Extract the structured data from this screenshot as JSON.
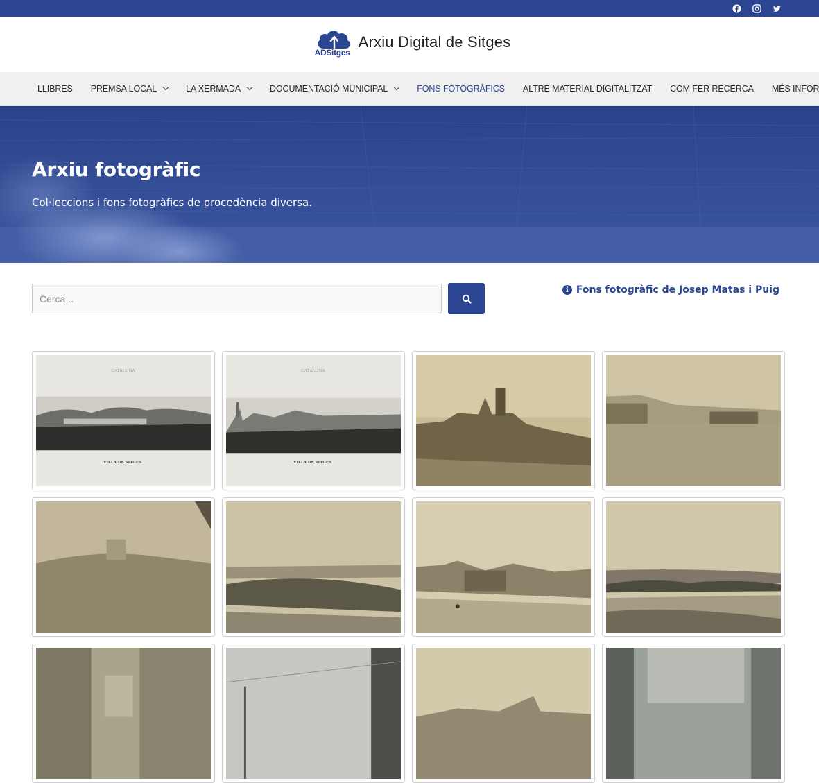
{
  "topbar": {
    "social": [
      {
        "name": "facebook-icon"
      },
      {
        "name": "instagram-icon"
      },
      {
        "name": "twitter-icon"
      }
    ]
  },
  "header": {
    "logo_sub": "ADSitges",
    "logo_title": "Arxiu Digital de Sitges"
  },
  "nav": {
    "items": [
      {
        "label": "LLIBRES",
        "dropdown": false
      },
      {
        "label": "PREMSA LOCAL",
        "dropdown": true
      },
      {
        "label": "LA XERMADA",
        "dropdown": true
      },
      {
        "label": "DOCUMENTACIÓ MUNICIPAL",
        "dropdown": true
      },
      {
        "label": "FONS FOTOGRÀFICS",
        "dropdown": false,
        "active": true
      },
      {
        "label": "ALTRE MATERIAL DIGITALITZAT",
        "dropdown": false
      },
      {
        "label": "COM FER RECERCA",
        "dropdown": false
      },
      {
        "label": "MÉS INFORMACIÓ",
        "dropdown": true
      }
    ]
  },
  "hero": {
    "title": "Arxiu fotogràfic",
    "subtitle": "Col·leccions i fons fotogràfics de procedència diversa."
  },
  "search": {
    "placeholder": "Cerca...",
    "value": ""
  },
  "info_link": {
    "label": "Fons fotogràfic de Josep Matas i Puig"
  },
  "gallery": {
    "photos": [
      {
        "tone": "bw",
        "caption": "CATALUÑA",
        "footer": "VILLA DE SITGES."
      },
      {
        "tone": "bw",
        "caption": "CATALUÑA",
        "footer": "VILLA DE SITGES."
      },
      {
        "tone": "sepia"
      },
      {
        "tone": "sepia"
      },
      {
        "tone": "sepia"
      },
      {
        "tone": "sepia"
      },
      {
        "tone": "sepia"
      },
      {
        "tone": "sepia"
      },
      {
        "tone": "sepia"
      },
      {
        "tone": "grey"
      },
      {
        "tone": "sepia"
      },
      {
        "tone": "grey"
      }
    ]
  },
  "colors": {
    "brand": "#2b4593",
    "nav_bg": "#f0f0f0"
  }
}
